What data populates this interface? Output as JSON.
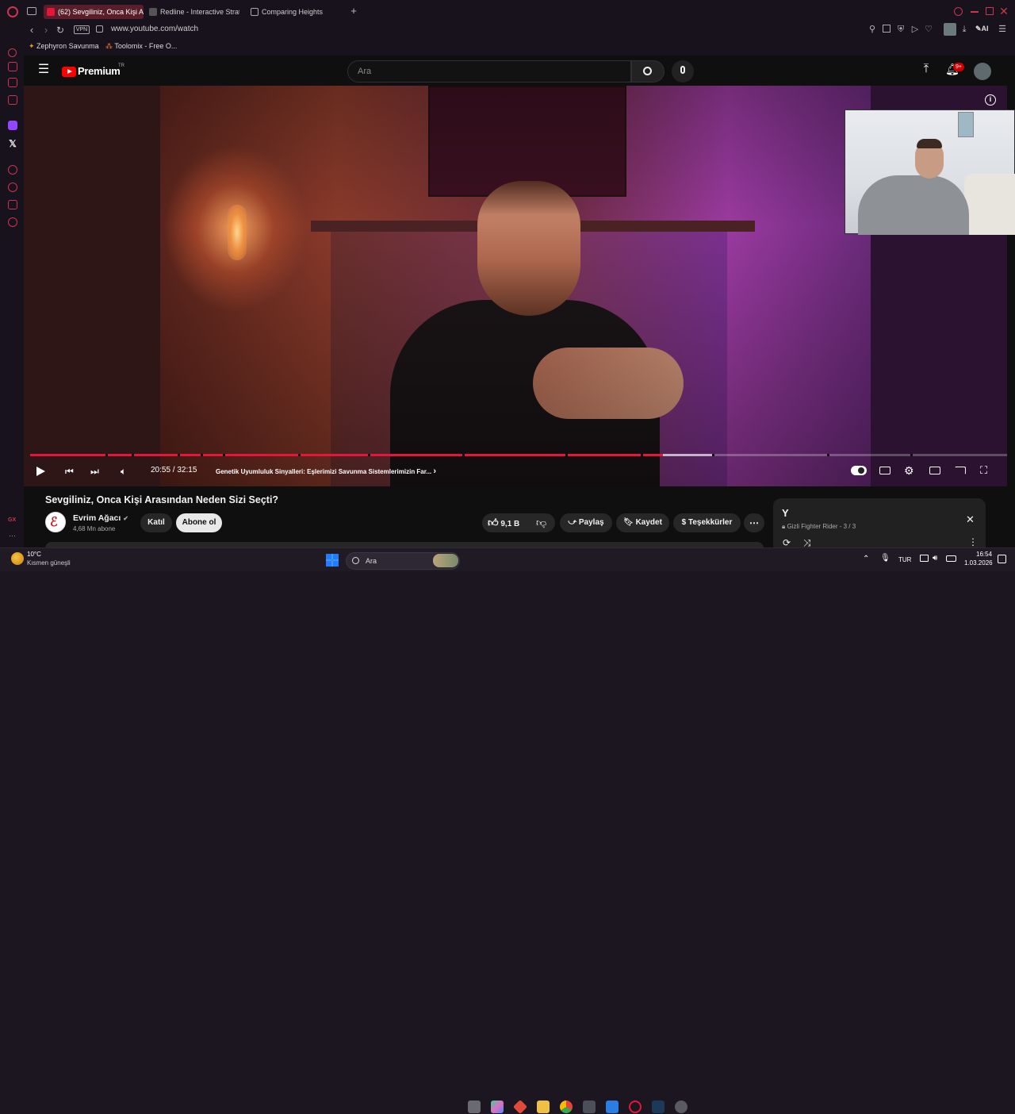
{
  "browser": {
    "tabs": [
      {
        "label": "(62) Sevgiliniz, Onca Kişi A",
        "active": true
      },
      {
        "label": "Redline - Interactive Strate"
      },
      {
        "label": "Comparing Heights"
      }
    ],
    "vpn_label": "VPN",
    "url": "www.youtube.com/watch",
    "ai_label": "AI",
    "bookmarks": [
      "Zephyron Savunma",
      "Toolomix - Free O..."
    ]
  },
  "youtube": {
    "logo_text": "Premium",
    "logo_sup": "TR",
    "search_placeholder": "Ara",
    "notif_badge": "9+"
  },
  "player": {
    "time": "20:55 / 32:15",
    "chapter": "Genetik Uyumluluk Sinyalleri: Eşlerimizi Savunma Sistemlerimizin Far...",
    "chapter_arrow": "›",
    "progress_fraction": 0.648,
    "buffered_fraction": 0.698
  },
  "video_info": {
    "title": "Sevgiliniz, Onca Kişi Arasından Neden Sizi Seçti?",
    "channel": "Evrim Ağacı",
    "subscribers": "4,68 Mn abone",
    "join_label": "Katıl",
    "subscribe_label": "Abone ol",
    "likes": "9,1 B",
    "share_label": "Paylaş",
    "save_label": "Kaydet",
    "thanks_label": "Teşekkürler",
    "more_label": "⋯"
  },
  "playlist": {
    "title": "Y",
    "subtitle": "Gizli",
    "sub_detail": "Fighter Rider - 3 / 3"
  },
  "sidebar": {
    "bottom_label": "GX",
    "more_label": "···"
  },
  "taskbar": {
    "weather_temp": "10°C",
    "weather_desc": "Kısmen güneşli",
    "search_placeholder": "Ara",
    "lang": "TUR",
    "time": "16:54",
    "date": "1.03.2026"
  },
  "colors": {
    "accent": "#e8153a",
    "opera": "#c9364d"
  }
}
